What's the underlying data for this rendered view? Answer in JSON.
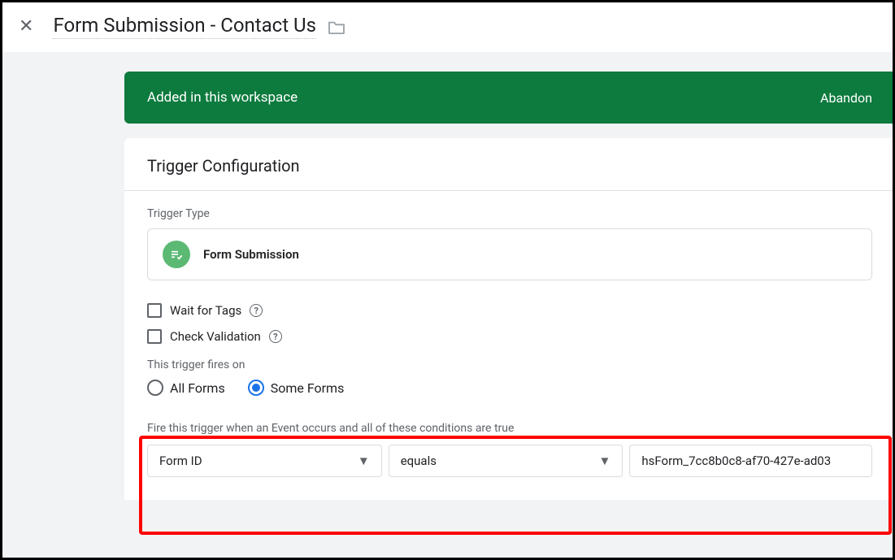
{
  "header": {
    "title": "Form Submission - Contact Us"
  },
  "banner": {
    "text": "Added in this workspace",
    "action": "Abandon"
  },
  "panel": {
    "title": "Trigger Configuration",
    "trigger_type_label": "Trigger Type",
    "trigger_type_value": "Form Submission",
    "wait_for_tags": "Wait for Tags",
    "check_validation": "Check Validation",
    "fires_on_label": "This trigger fires on",
    "radio_all": "All Forms",
    "radio_some": "Some Forms",
    "condition_label": "Fire this trigger when an Event occurs and all of these conditions are true",
    "cond_variable": "Form ID",
    "cond_operator": "equals",
    "cond_value": "hsForm_7cc8b0c8-af70-427e-ad03"
  }
}
